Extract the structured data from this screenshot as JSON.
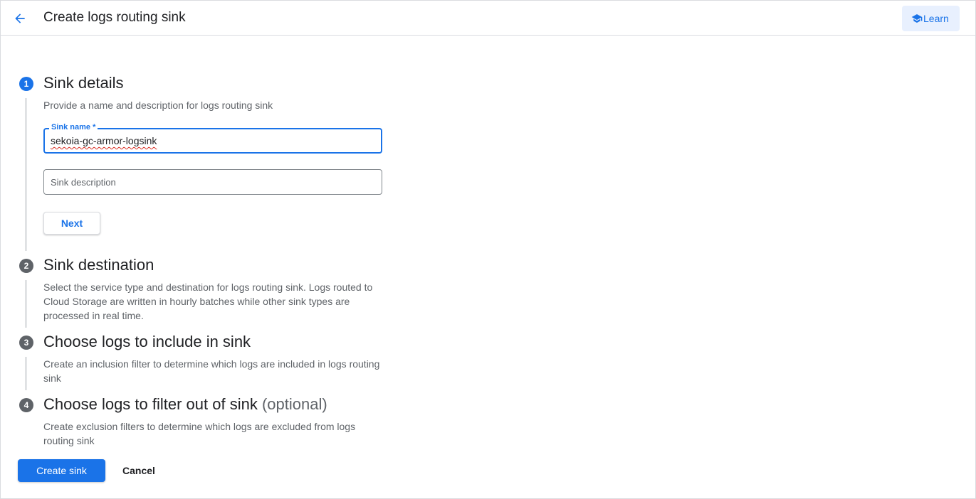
{
  "header": {
    "title": "Create logs routing sink",
    "learn_label": "Learn"
  },
  "steps": [
    {
      "number": "1",
      "title": "Sink details",
      "description": "Provide a name and description for logs routing sink"
    },
    {
      "number": "2",
      "title": "Sink destination",
      "description": "Select the service type and destination for logs routing sink. Logs routed to Cloud Storage are written in hourly batches while other sink types are processed in real time."
    },
    {
      "number": "3",
      "title": "Choose logs to include in sink",
      "description": "Create an inclusion filter to determine which logs are included in logs routing sink"
    },
    {
      "number": "4",
      "title": "Choose logs to filter out of sink",
      "optional": "(optional)",
      "description": "Create exclusion filters to determine which logs are excluded from logs routing sink"
    }
  ],
  "form": {
    "sink_name_label": "Sink name *",
    "sink_name_value": "sekoia-gc-armor-logsink",
    "sink_description_placeholder": "Sink description",
    "next_label": "Next"
  },
  "actions": {
    "create_label": "Create sink",
    "cancel_label": "Cancel"
  },
  "colors": {
    "accent": "#1a73e8",
    "inactive_step": "#5f6368",
    "text": "#202124",
    "secondary_text": "#5f6368"
  }
}
